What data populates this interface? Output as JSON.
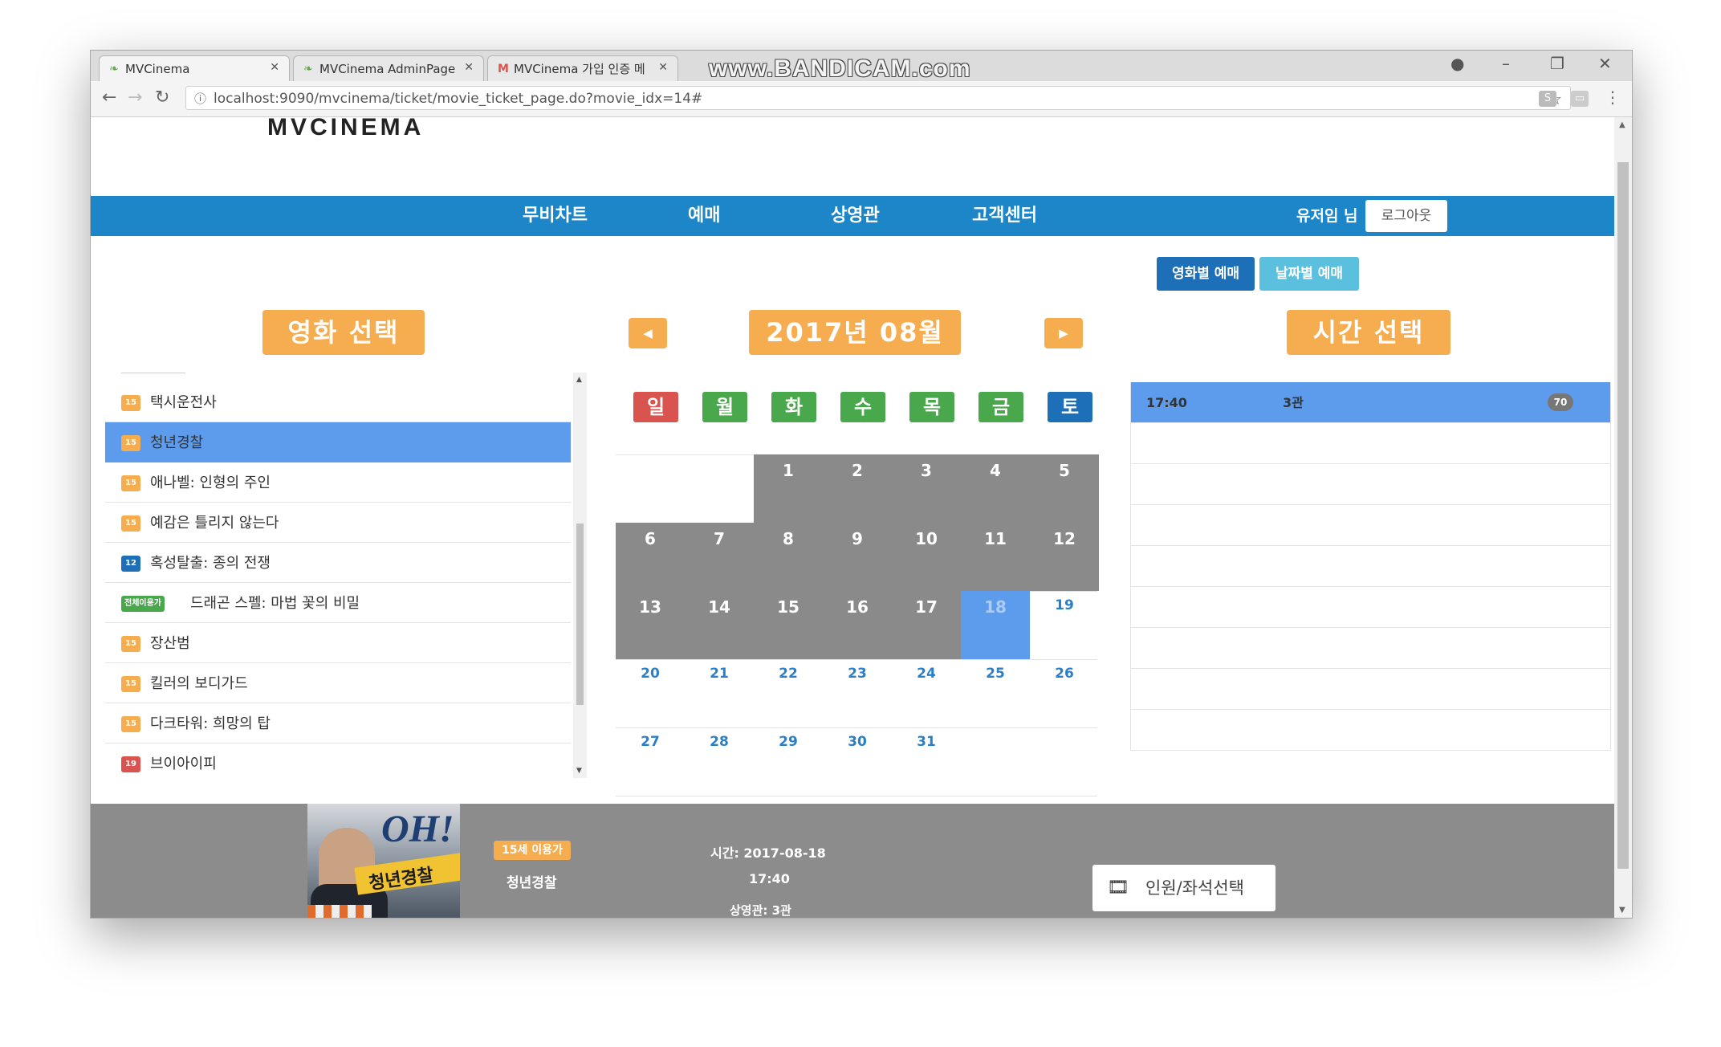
{
  "browser": {
    "tabs": [
      {
        "label": "MVCinema",
        "favicon": "leaf-icon",
        "active": true
      },
      {
        "label": "MVCinema AdminPage",
        "favicon": "leaf-icon",
        "active": false
      },
      {
        "label": "MVCinema 가입 인증 메",
        "favicon": "gmail-icon",
        "active": false
      }
    ],
    "watermark": "www.BANDICAM.com",
    "url": "localhost:9090/mvcinema/ticket/movie_ticket_page.do?movie_idx=14#"
  },
  "header": {
    "logo": "MVCINEMA",
    "nav": [
      "무비차트",
      "예매",
      "상영관",
      "고객센터"
    ],
    "user": "유저임 님",
    "logout": "로그아웃"
  },
  "modes": {
    "by_movie": "영화별 예매",
    "by_date": "날짜별 예매"
  },
  "movie_panel": {
    "title": "영화 선택",
    "movies": [
      {
        "rating": "15",
        "rating_color": "#f6ad4f",
        "title": "택시운전사",
        "selected": false
      },
      {
        "rating": "15",
        "rating_color": "#f6ad4f",
        "title": "청년경찰",
        "selected": true
      },
      {
        "rating": "15",
        "rating_color": "#f6ad4f",
        "title": "애나벨: 인형의 주인",
        "selected": false
      },
      {
        "rating": "15",
        "rating_color": "#f6ad4f",
        "title": "예감은 틀리지 않는다",
        "selected": false
      },
      {
        "rating": "12",
        "rating_color": "#1d6fb8",
        "title": "혹성탈출: 종의 전쟁",
        "selected": false
      },
      {
        "rating": "전체이용가",
        "rating_color": "#4aa84c",
        "title": "드래곤 스펠: 마법 꽃의 비밀",
        "selected": false
      },
      {
        "rating": "15",
        "rating_color": "#f6ad4f",
        "title": "장산범",
        "selected": false
      },
      {
        "rating": "15",
        "rating_color": "#f6ad4f",
        "title": "킬러의 보디가드",
        "selected": false
      },
      {
        "rating": "15",
        "rating_color": "#f6ad4f",
        "title": "다크타워: 희망의 탑",
        "selected": false
      },
      {
        "rating": "19",
        "rating_color": "#d9534f",
        "title": "브이아이피",
        "selected": false
      }
    ]
  },
  "calendar": {
    "month_label": "2017년 08월",
    "weekdays": [
      {
        "label": "일",
        "color": "#d9534f"
      },
      {
        "label": "월",
        "color": "#4aa84c"
      },
      {
        "label": "화",
        "color": "#4aa84c"
      },
      {
        "label": "수",
        "color": "#4aa84c"
      },
      {
        "label": "목",
        "color": "#4aa84c"
      },
      {
        "label": "금",
        "color": "#4aa84c"
      },
      {
        "label": "토",
        "color": "#1d6fb8"
      }
    ],
    "days": [
      {
        "d": "1",
        "state": "past"
      },
      {
        "d": "2",
        "state": "past"
      },
      {
        "d": "3",
        "state": "past"
      },
      {
        "d": "4",
        "state": "past"
      },
      {
        "d": "5",
        "state": "past"
      },
      {
        "d": "6",
        "state": "past"
      },
      {
        "d": "7",
        "state": "past"
      },
      {
        "d": "8",
        "state": "past"
      },
      {
        "d": "9",
        "state": "past"
      },
      {
        "d": "10",
        "state": "past"
      },
      {
        "d": "11",
        "state": "past"
      },
      {
        "d": "12",
        "state": "past"
      },
      {
        "d": "13",
        "state": "past"
      },
      {
        "d": "14",
        "state": "past"
      },
      {
        "d": "15",
        "state": "past"
      },
      {
        "d": "16",
        "state": "past"
      },
      {
        "d": "17",
        "state": "past"
      },
      {
        "d": "18",
        "state": "selected"
      },
      {
        "d": "19",
        "state": "future"
      },
      {
        "d": "20",
        "state": "future"
      },
      {
        "d": "21",
        "state": "future"
      },
      {
        "d": "22",
        "state": "future"
      },
      {
        "d": "23",
        "state": "future"
      },
      {
        "d": "24",
        "state": "future"
      },
      {
        "d": "25",
        "state": "future"
      },
      {
        "d": "26",
        "state": "future"
      },
      {
        "d": "27",
        "state": "future"
      },
      {
        "d": "28",
        "state": "future"
      },
      {
        "d": "29",
        "state": "future"
      },
      {
        "d": "30",
        "state": "future"
      },
      {
        "d": "31",
        "state": "future"
      }
    ]
  },
  "time_panel": {
    "title": "시간 선택",
    "times": [
      {
        "time": "17:40",
        "hall": "3관",
        "seats": "70",
        "selected": true
      }
    ]
  },
  "footer": {
    "poster_logo": "OH!",
    "poster_title": "청년경찰",
    "age_badge": "15세 이용가",
    "movie_title": "청년경찰",
    "date_line": "시간: 2017-08-18",
    "time_line": "17:40",
    "hall_line": "상영관: 3관",
    "seat_button": "인원/좌석선택"
  },
  "colors": {
    "brand_blue": "#1d86c8",
    "accent_orange": "#f6ad4f",
    "selected_blue": "#5d9cec"
  }
}
